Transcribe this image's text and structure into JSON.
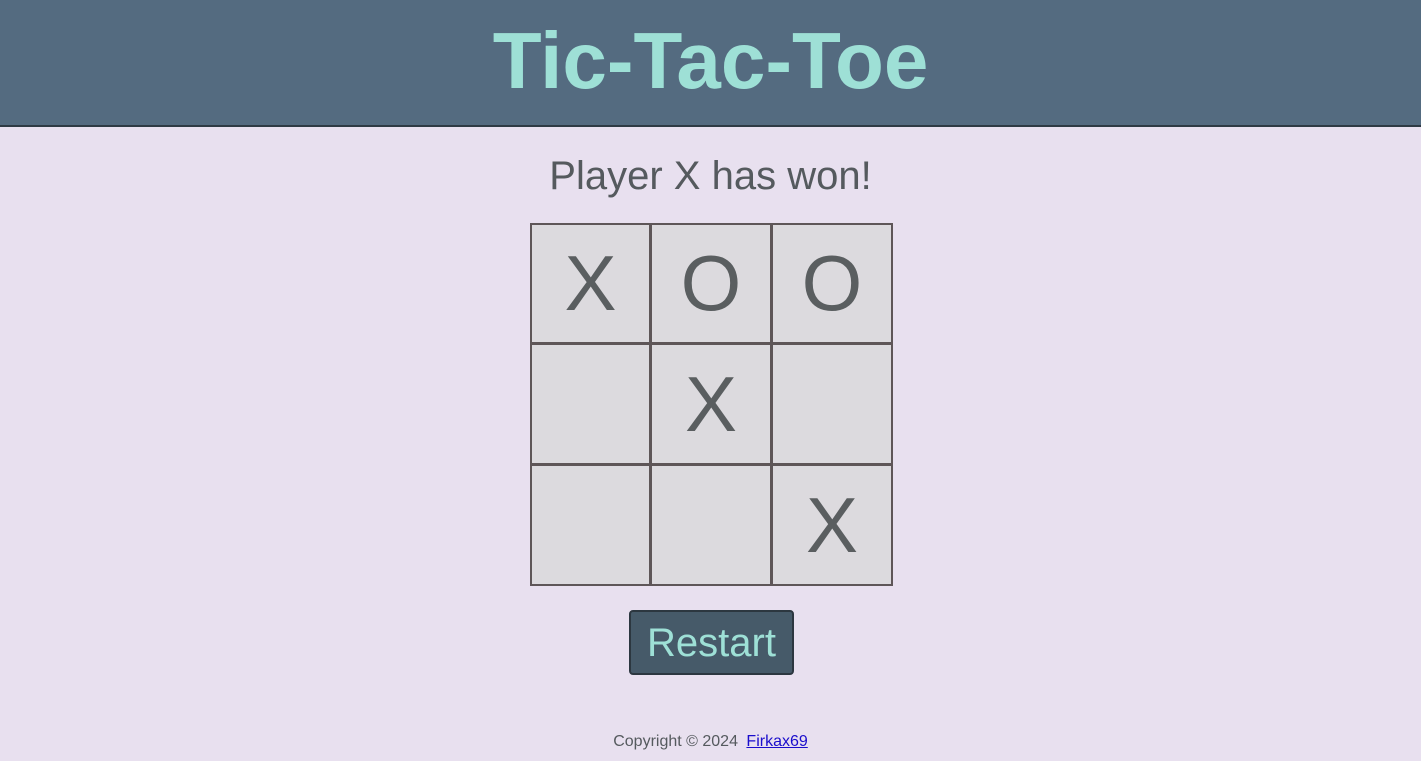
{
  "header": {
    "title": "Tic-Tac-Toe"
  },
  "game": {
    "status": "Player X has won!",
    "board": [
      "X",
      "O",
      "O",
      "",
      "X",
      "",
      "",
      "",
      "X"
    ],
    "restart_label": "Restart"
  },
  "footer": {
    "copyright": "Copyright © 2024",
    "author_link": "Firkax69"
  },
  "colors": {
    "header_bg": "#546b80",
    "title": "#9ee0d6",
    "page_bg": "#e8e0ef",
    "cell_bg": "#dcdade",
    "button_bg": "#465a69"
  }
}
